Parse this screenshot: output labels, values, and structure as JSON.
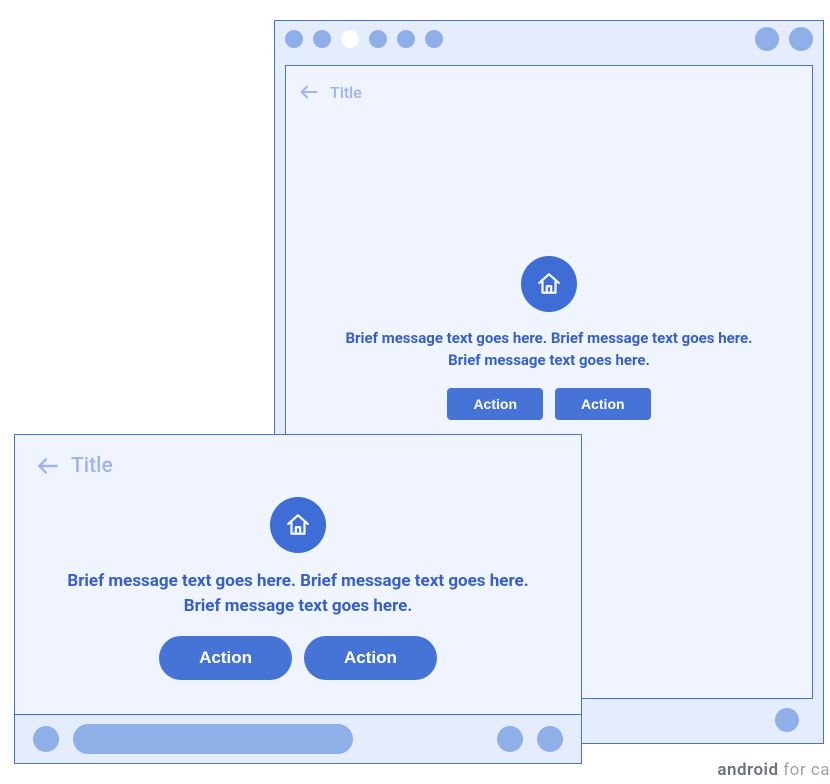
{
  "colors": {
    "primary": "#4573d6",
    "primary_dark": "#3e6dd6",
    "surface": "#eff4fe",
    "mock_bg": "#e5edfc",
    "muted": "#8fafe9"
  },
  "back": {
    "title": "Title",
    "message": "Brief message text goes here. Brief message text goes here. Brief message text goes here.",
    "icon": "home-icon",
    "actions": [
      "Action",
      "Action"
    ]
  },
  "front": {
    "title": "Title",
    "message": "Brief message text goes here. Brief message text goes here. Brief message text goes here.",
    "icon": "home-icon",
    "actions": [
      "Action",
      "Action"
    ]
  },
  "watermark": {
    "brand": "android",
    "rest": " for ca"
  }
}
